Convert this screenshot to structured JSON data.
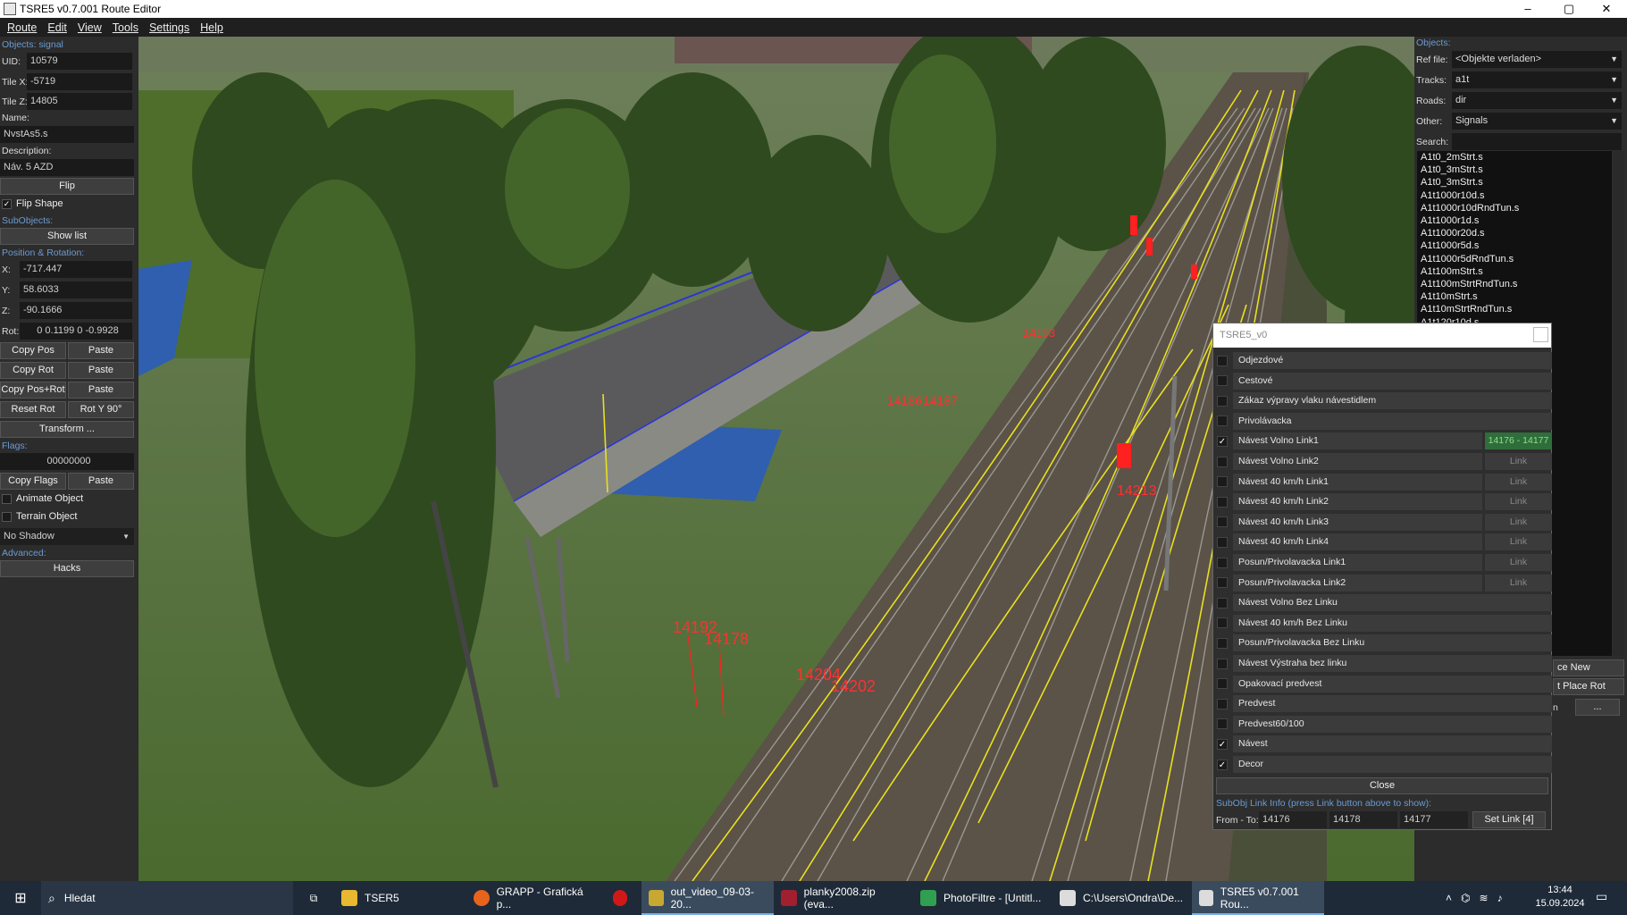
{
  "window": {
    "title": "TSRE5 v0.7.001 Route Editor",
    "min": "–",
    "max": "▢",
    "close": "✕"
  },
  "menu": [
    "Route",
    "Edit",
    "View",
    "Tools",
    "Settings",
    "Help"
  ],
  "left": {
    "objects_label": "Objects: signal",
    "uid_label": "UID:",
    "uid": "10579",
    "tilex_label": "Tile X:",
    "tilex": "-5719",
    "tilez_label": "Tile Z:",
    "tilez": "14805",
    "name_label": "Name:",
    "name": "NvstAs5.s",
    "desc_label": "Description:",
    "desc": "Náv. 5 AZD",
    "flip": "Flip",
    "flip_shape": "Flip Shape",
    "subobjects_label": "SubObjects:",
    "show_list": "Show list",
    "pos_label": "Position & Rotation:",
    "x_label": "X:",
    "x": "-717.447",
    "y_label": "Y:",
    "y": "58.6033",
    "z_label": "Z:",
    "z": "-90.1666",
    "rot_label": "Rot:",
    "rot": "0 0.1199 0 -0.9928",
    "copy_pos": "Copy Pos",
    "paste1": "Paste",
    "copy_rot": "Copy Rot",
    "paste2": "Paste",
    "copy_posrot": "Copy Pos+Rot",
    "paste3": "Paste",
    "reset_rot": "Reset Rot",
    "rot_y90": "Rot Y 90°",
    "transform": "Transform ...",
    "flags_label": "Flags:",
    "flags": "00000000",
    "copy_flags": "Copy Flags",
    "paste4": "Paste",
    "animate": "Animate Object",
    "terrain": "Terrain Object",
    "shadow": "No Shadow",
    "advanced_label": "Advanced:",
    "hacks": "Hacks"
  },
  "right": {
    "objects_label": "Objects:",
    "ref_label": "Ref file:",
    "ref": "<Objekte verladen>",
    "tracks_label": "Tracks:",
    "tracks": "a1t",
    "roads_label": "Roads:",
    "roads": "dir",
    "other_label": "Other:",
    "other": "Signals",
    "search_label": "Search:",
    "list": [
      "A1t0_2mStrt.s",
      "A1t0_3mStrt.s",
      "A1t0_3mStrt.s",
      "A1t1000r10d.s",
      "A1t1000r10dRndTun.s",
      "A1t1000r1d.s",
      "A1t1000r20d.s",
      "A1t1000r5d.s",
      "A1t1000r5dRndTun.s",
      "A1t100mStrt.s",
      "A1t100mStrtRndTun.s",
      "A1t10mStrt.s",
      "A1t10mStrtRndTun.s",
      "A1t120r10d.s"
    ],
    "place_new": "ce New",
    "place_rot": "t Place Rot",
    "n": "n",
    "dots": "..."
  },
  "dialog": {
    "title": "TSRE5_v0",
    "rows": [
      {
        "label": "Odjezdové",
        "checked": false
      },
      {
        "label": "Cestové",
        "checked": false
      },
      {
        "label": "Zákaz výpravy vlaku návestidlem",
        "checked": false
      },
      {
        "label": "Privolávacka",
        "checked": false
      },
      {
        "label": "Návest Volno Link1",
        "checked": true,
        "link": "14176 - 14177",
        "active": true
      },
      {
        "label": "Návest Volno Link2",
        "checked": false,
        "link": "Link"
      },
      {
        "label": "Návest 40 km/h Link1",
        "checked": false,
        "link": "Link"
      },
      {
        "label": "Návest 40 km/h Link2",
        "checked": false,
        "link": "Link"
      },
      {
        "label": "Návest 40 km/h Link3",
        "checked": false,
        "link": "Link"
      },
      {
        "label": "Návest 40 km/h Link4",
        "checked": false,
        "link": "Link"
      },
      {
        "label": "Posun/Privolavacka Link1",
        "checked": false,
        "link": "Link"
      },
      {
        "label": "Posun/Privolavacka Link2",
        "checked": false,
        "link": "Link"
      },
      {
        "label": "Návest Volno Bez Linku",
        "checked": false
      },
      {
        "label": "Návest 40 km/h Bez Linku",
        "checked": false
      },
      {
        "label": "Posun/Privolavacka Bez Linku",
        "checked": false
      },
      {
        "label": "Návest Výstraha bez linku",
        "checked": false
      },
      {
        "label": "Opakovací predvest",
        "checked": false
      },
      {
        "label": "Predvest",
        "checked": false
      },
      {
        "label": "Predvest60/100",
        "checked": false
      },
      {
        "label": "Návest",
        "checked": true
      },
      {
        "label": "Decor",
        "checked": true
      }
    ],
    "close": "Close",
    "info": "SubObj Link Info (press Link button above to show):",
    "from_to": "From - To:",
    "f1": "14176",
    "f2": "14178",
    "f3": "14177",
    "set_link": "Set Link [4]"
  },
  "scene": {
    "labels": [
      "14192",
      "14178",
      "14204",
      "14202",
      "14213",
      "14186",
      "14187",
      "14193"
    ]
  },
  "taskbar": {
    "search": "Hledat",
    "apps": [
      "TSER5",
      "GRAPP - Grafická p...",
      "",
      "out_video_09-03-20...",
      "planky2008.zip (eva...",
      "PhotoFiltre - [Untitl...",
      "C:\\Users\\Ondra\\De...",
      "TSRE5 v0.7.001 Rou..."
    ],
    "time": "13:44",
    "date": "15.09.2024"
  },
  "colors": {
    "panel": "#2c2c2c",
    "field": "#1a1a1a",
    "accent_blue": "#6b9bd2",
    "link_active": "#2f6e3a",
    "track_yellow": "#e8e020",
    "signal_red": "#ff2020"
  }
}
